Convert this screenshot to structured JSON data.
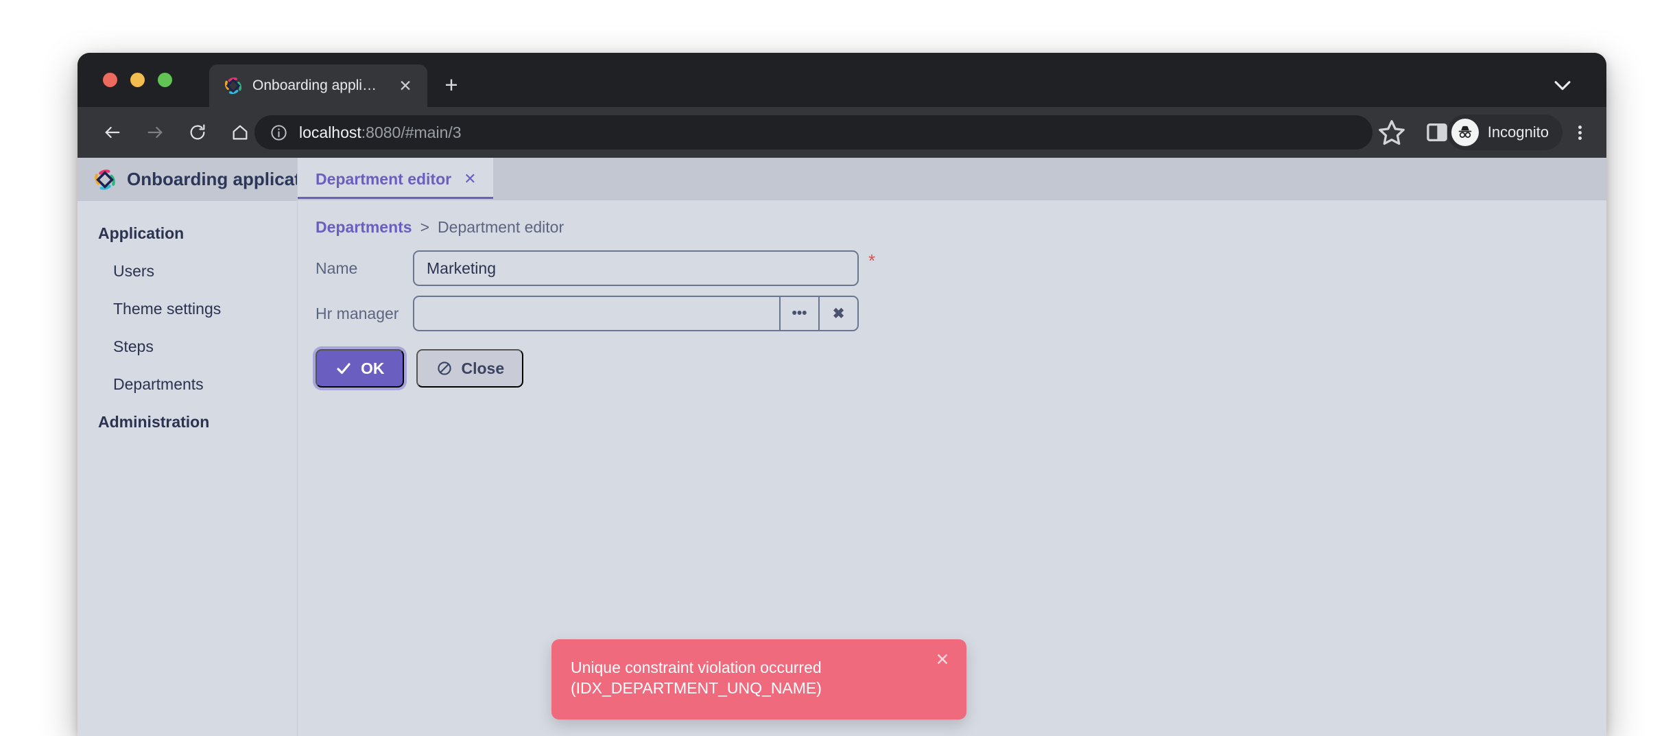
{
  "browser": {
    "tab": {
      "title": "Onboarding application",
      "favicon_icon": "app-diamond-logo-icon",
      "close_icon": "✕"
    },
    "new_tab_icon": "+",
    "tabstrip_expand_icon": "chevron-down-icon",
    "toolbar": {
      "back_icon": "←",
      "forward_icon": "→",
      "reload_icon": "⟳",
      "home_icon": "⌂",
      "site_info_icon": "info-circle-icon",
      "url_host": "localhost",
      "url_rest": ":8080/#main/3",
      "url_full": "localhost:8080/#main/3",
      "bookmark_icon": "star-outline-icon",
      "side_panel_icon": "side-panel-icon",
      "incognito_label": "Incognito",
      "incognito_icon": "incognito-hat-glasses-icon",
      "menu_icon": "three-dots-vertical-icon"
    }
  },
  "app": {
    "brand": {
      "title": "Onboarding application",
      "logo_icon": "diamond-logo-icon"
    },
    "sidebar": {
      "groups": [
        {
          "title": "Application",
          "items": [
            {
              "label": "Users"
            },
            {
              "label": "Theme settings"
            },
            {
              "label": "Steps"
            },
            {
              "label": "Departments"
            }
          ]
        },
        {
          "title": "Administration",
          "items": []
        }
      ]
    },
    "view_tabs": [
      {
        "label": "Department editor",
        "close_icon": "✕",
        "active": true
      }
    ],
    "breadcrumb": {
      "link": "Departments",
      "separator": ">",
      "current": "Department editor"
    },
    "form": {
      "fields": [
        {
          "label": "Name",
          "value": "Marketing",
          "placeholder": "",
          "required_mark": "*"
        },
        {
          "label": "Hr manager",
          "value": "",
          "placeholder": "",
          "lookup_icon": "•••",
          "clear_icon": "✖"
        }
      ],
      "actions": [
        {
          "label": "OK",
          "icon": "check-icon"
        },
        {
          "label": "Close",
          "icon": "ban-circle-icon"
        }
      ]
    },
    "toast": {
      "line1": "Unique constraint violation occurred",
      "line2": "(IDX_DEPARTMENT_UNQ_NAME)",
      "close_icon": "✕"
    }
  },
  "colors": {
    "accent_purple": "#6a5fc1",
    "error_red": "#ef6a7d",
    "required_red": "#d9534f",
    "app_bg": "#d6dae2",
    "app_bar_bg": "#c2c7d2",
    "text_navy": "#2b3350",
    "text_muted": "#5c6480"
  }
}
